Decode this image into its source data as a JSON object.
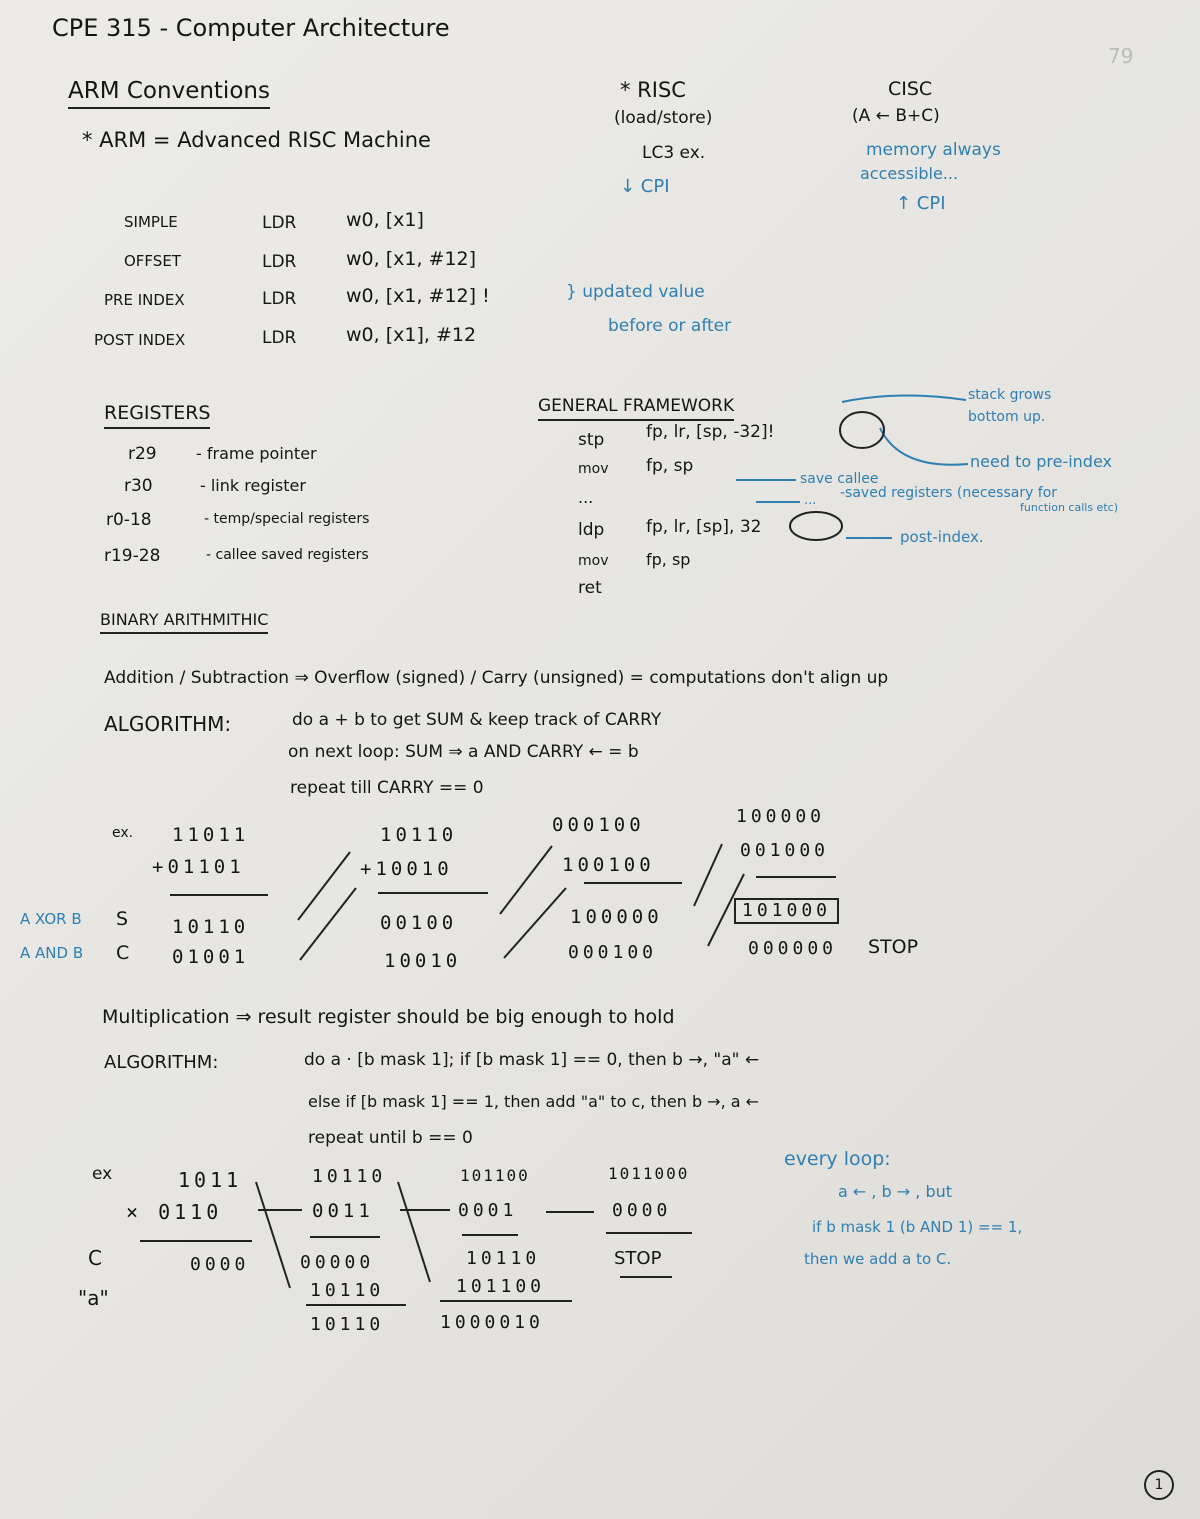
{
  "header": {
    "course_title": "CPE 315 - Computer Architecture",
    "corner_mark": "79",
    "page_number": "1"
  },
  "arm": {
    "heading": "ARM Conventions",
    "definition": "* ARM = Advanced RISC Machine",
    "risc": {
      "title": "* RISC",
      "lines": [
        "(load/store)",
        "LC3 ex.",
        "↓ CPI"
      ]
    },
    "cisc": {
      "title": "CISC",
      "lines": [
        "(A ← B+C)",
        "memory always",
        "accessible...",
        "↑ CPI"
      ]
    },
    "addressing_modes": [
      {
        "mode": "SIMPLE",
        "op": "LDR",
        "operands": "w0, [x1]"
      },
      {
        "mode": "OFFSET",
        "op": "LDR",
        "operands": "w0, [x1, #12]"
      },
      {
        "mode": "PRE INDEX",
        "op": "LDR",
        "operands": "w0, [x1, #12] !"
      },
      {
        "mode": "POST INDEX",
        "op": "LDR",
        "operands": "w0, [x1], #12"
      }
    ],
    "index_note": [
      "} updated value",
      "before or after"
    ]
  },
  "registers": {
    "heading": "REGISTERS",
    "items": [
      {
        "reg": "r29",
        "desc": "- frame pointer"
      },
      {
        "reg": "r30",
        "desc": "- link register"
      },
      {
        "reg": "r0-18",
        "desc": "- temp/special registers"
      },
      {
        "reg": "r19-28",
        "desc": "- callee saved registers"
      }
    ]
  },
  "framework": {
    "heading": "GENERAL FRAMEWORK",
    "code": [
      {
        "op": "stp",
        "args": "fp, lr, [sp, -32]!"
      },
      {
        "op": "mov",
        "args": "fp, sp"
      },
      {
        "op": "...",
        "args": ""
      },
      {
        "op": "ldp",
        "args": "fp, lr, [sp], 32"
      },
      {
        "op": "mov",
        "args": "fp, sp"
      },
      {
        "op": "ret",
        "args": ""
      }
    ],
    "annotations": {
      "stack": [
        "stack grows",
        "bottom up."
      ],
      "pre_index": "need to pre-index",
      "save_callee": [
        "save callee",
        "-saved registers (necessary for",
        "function calls etc)"
      ],
      "dots": "...",
      "post_index": "post-index."
    }
  },
  "binary": {
    "heading": "BINARY ARITHMITHIC",
    "add_sub_line": "Addition / Subtraction ⇒ Overflow (signed) / Carry (unsigned) = computations don't align up",
    "algorithm_label": "ALGORITHM:",
    "algorithm_lines": [
      "do a + b to get SUM & keep track of CARRY",
      "on next loop: SUM ⇒ a AND CARRY ← = b",
      "repeat till CARRY == 0"
    ],
    "add_example": {
      "ex_label": "ex.",
      "xor_label": "A XOR B",
      "and_label": "A AND B",
      "s_label": "S",
      "c_label": "C",
      "steps": [
        {
          "a": "11011",
          "b": "+01101",
          "s": "10110",
          "c": "01001"
        },
        {
          "a": "10110",
          "b": "+10010",
          "s": "00100",
          "c": "10010"
        },
        {
          "a": "000100",
          "b": "100100",
          "s": "100000",
          "c": "000100"
        },
        {
          "a": "100000",
          "b": "001000",
          "s": "101000",
          "c": "000000"
        }
      ],
      "stop": "STOP",
      "shift_mark": "←"
    }
  },
  "multiplication": {
    "line": "Multiplication ⇒ result register should be big enough to hold",
    "algorithm_label": "ALGORITHM:",
    "algorithm_lines": [
      "do a · [b mask 1]; if [b mask 1] == 0, then b →, \"a\" ←",
      "else if [b mask 1] == 1, then add \"a\" to c, then b →, a ←",
      "repeat until b == 0"
    ],
    "example": {
      "ex_label": "ex",
      "c_label": "C",
      "a_label": "\"a\"",
      "steps": [
        {
          "a": "1011",
          "b": "× 0110",
          "c": "0000",
          "add": "",
          "sum": ""
        },
        {
          "a": "10110",
          "b": "0011",
          "c": "00000",
          "add": "10110",
          "sum": "10110"
        },
        {
          "a": "101100",
          "b": "0001",
          "c": "10110",
          "add": "101100",
          "sum": "1000010"
        },
        {
          "a": "1011000",
          "b": "0000",
          "c": "STOP",
          "add": "",
          "sum": ""
        }
      ]
    },
    "every_loop": {
      "title": "every loop:",
      "lines": [
        "a ← , b → , but",
        "if   b mask 1 (b AND 1) == 1,",
        "then we add a to C."
      ]
    }
  }
}
